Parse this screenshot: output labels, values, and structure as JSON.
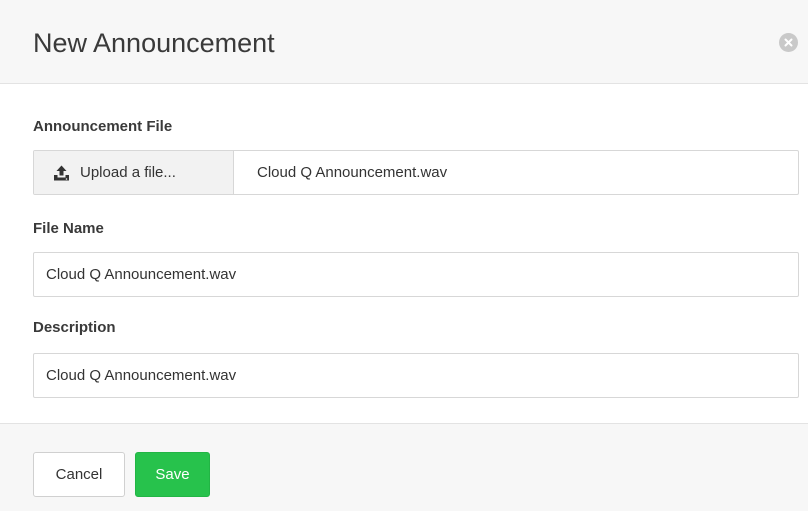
{
  "dialog": {
    "title": "New Announcement"
  },
  "form": {
    "announcement_file": {
      "label": "Announcement File",
      "upload_button_label": "Upload a file...",
      "selected_file": "Cloud Q Announcement.wav"
    },
    "file_name": {
      "label": "File Name",
      "value": "Cloud Q Announcement.wav"
    },
    "description": {
      "label": "Description",
      "value": "Cloud Q Announcement.wav"
    }
  },
  "footer": {
    "cancel_label": "Cancel",
    "save_label": "Save"
  },
  "colors": {
    "save_button": "#27c24c",
    "header_background": "#f7f7f7",
    "close_icon": "#c9c9c9"
  },
  "icons": {
    "upload": "upload-icon",
    "close": "close-icon"
  }
}
